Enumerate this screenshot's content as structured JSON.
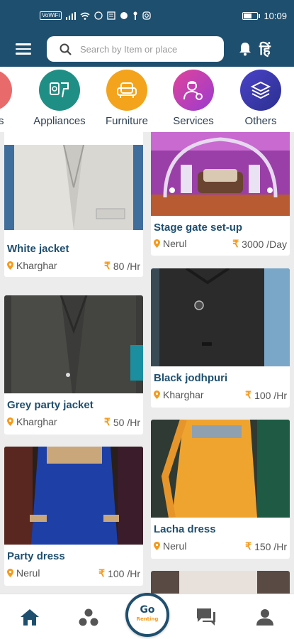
{
  "status_bar": {
    "left_chip": "VoWiFi",
    "time": "10:09",
    "battery_level": 0.6
  },
  "header": {
    "search_placeholder": "Search by Item or place",
    "language_label": "हिं",
    "menu_icon": "hamburger-menu-icon",
    "notification_icon": "bell-icon"
  },
  "categories": [
    {
      "label": "Tools",
      "icon": "tools-icon",
      "color": "#e96a6a"
    },
    {
      "label": "Appliances",
      "icon": "appliances-icon",
      "color": "#1f8f86"
    },
    {
      "label": "Furniture",
      "icon": "sofa-icon",
      "color": "#f3a41c"
    },
    {
      "label": "Services",
      "icon": "service-person-icon",
      "color": "#c83fa8"
    },
    {
      "label": "Others",
      "icon": "layers-icon",
      "color": "#3a3fb0"
    }
  ],
  "products": {
    "left": [
      {
        "name": "White jacket",
        "location": "Kharghar",
        "price": "80 /Hr",
        "image": "white-jacket-photo"
      },
      {
        "name": "Grey party jacket",
        "location": "Kharghar",
        "price": "50 /Hr",
        "image": "grey-jacket-photo"
      },
      {
        "name": "Party dress",
        "location": "Nerul",
        "price": "100 /Hr",
        "image": "blue-party-dress-photo"
      }
    ],
    "right": [
      {
        "name": "Stage gate set-up",
        "location": "Nerul",
        "price": "3000 /Day",
        "image": "stage-setup-photo"
      },
      {
        "name": "Black jodhpuri",
        "location": "Kharghar",
        "price": "100 /Hr",
        "image": "black-jodhpuri-photo"
      },
      {
        "name": "Lacha dress",
        "location": "Nerul",
        "price": "150 /Hr",
        "image": "lacha-dress-photo"
      }
    ]
  },
  "currency_symbol": "₹",
  "bottom_nav": {
    "items": [
      "home-icon",
      "categories-dots-icon",
      "chat-icon",
      "profile-icon"
    ],
    "logo_top": "Go",
    "logo_bottom": "Renting",
    "accent": "#1f4f6e"
  },
  "colors": {
    "brand": "#1f4f6e",
    "accent_orange": "#f59a1c"
  }
}
